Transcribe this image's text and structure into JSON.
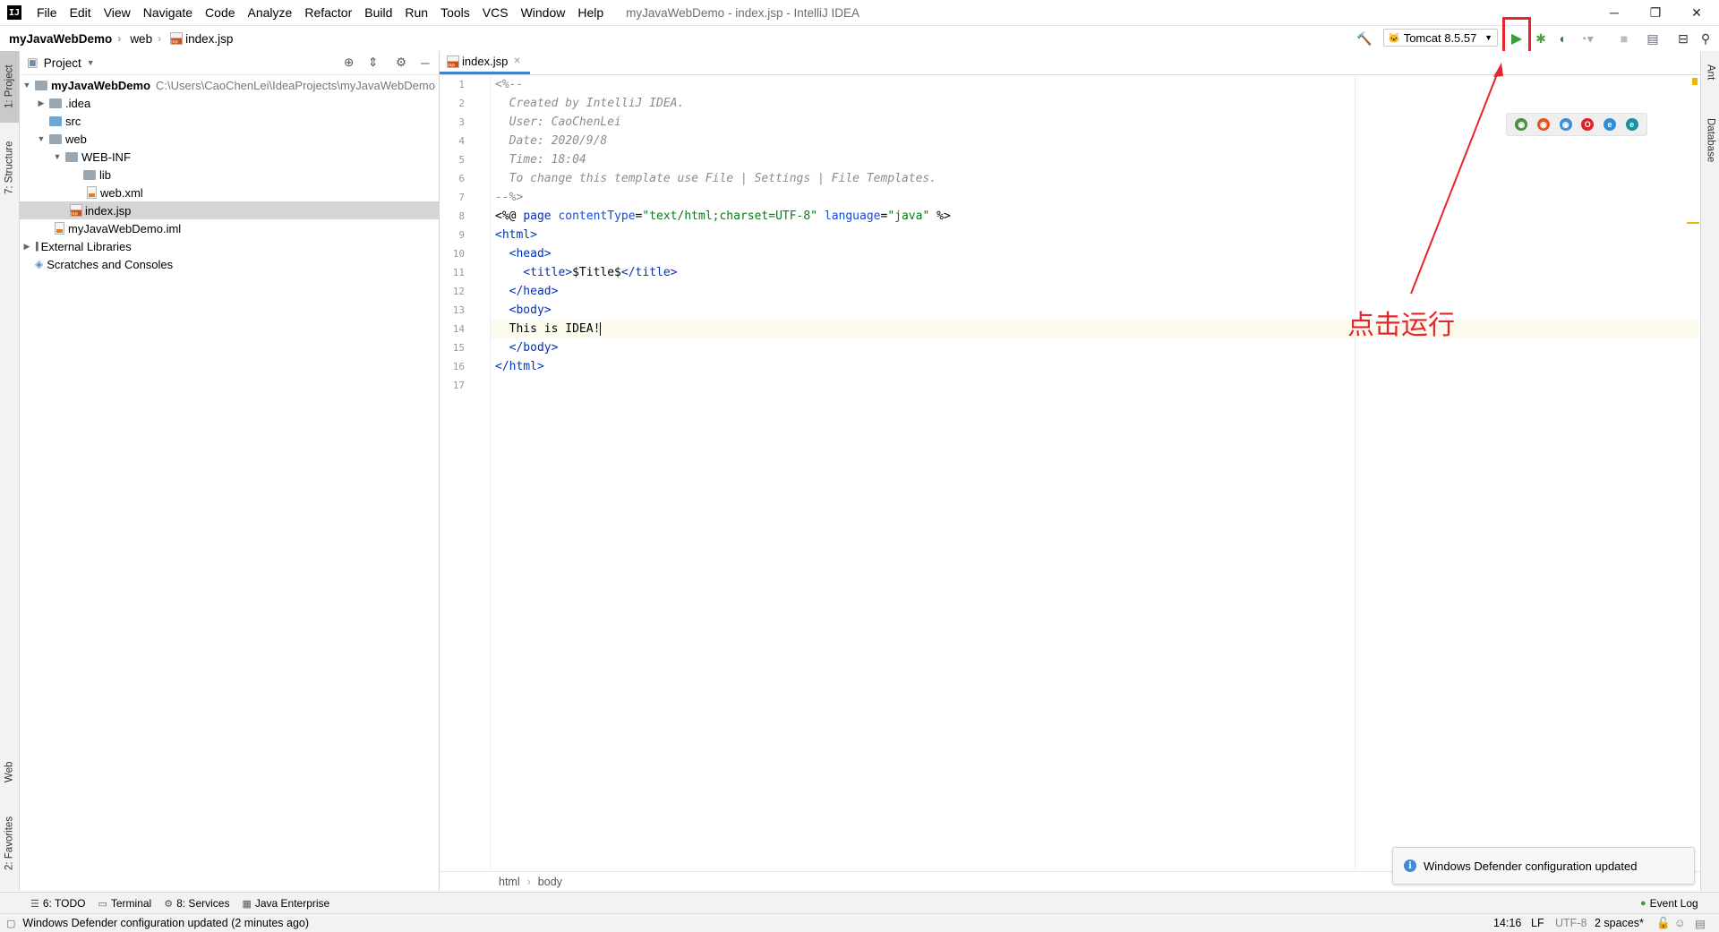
{
  "app": {
    "logo_text": "IJ",
    "window_title": "myJavaWebDemo - index.jsp - IntelliJ IDEA",
    "menu": [
      "File",
      "Edit",
      "View",
      "Navigate",
      "Code",
      "Analyze",
      "Refactor",
      "Build",
      "Run",
      "Tools",
      "VCS",
      "Window",
      "Help"
    ]
  },
  "window_controls": {
    "minimize": "─",
    "restore": "❐",
    "close": "✕"
  },
  "navbar": {
    "crumbs": [
      "myJavaWebDemo",
      "web",
      "index.jsp"
    ],
    "run_config": "Tomcat 8.5.57"
  },
  "toolbar_icons": [
    "build-hammer-icon",
    "run-icon",
    "debug-icon",
    "coverage-icon",
    "profile-icon",
    "stop-icon",
    "project-structure-icon",
    "layout-icon",
    "search-icon"
  ],
  "left_stripe": {
    "project": "1: Project",
    "structure": "7: Structure",
    "web": "Web",
    "favorites": "2: Favorites"
  },
  "right_stripe": {
    "ant": "Ant",
    "database": "Database"
  },
  "project_panel": {
    "title": "Project",
    "root": {
      "name": "myJavaWebDemo",
      "path": "C:\\Users\\CaoChenLei\\IdeaProjects\\myJavaWebDemo"
    },
    "items": [
      {
        "label": ".idea"
      },
      {
        "label": "src"
      },
      {
        "label": "web"
      },
      {
        "label": "WEB-INF"
      },
      {
        "label": "lib"
      },
      {
        "label": "web.xml"
      },
      {
        "label": "index.jsp"
      },
      {
        "label": "myJavaWebDemo.iml"
      },
      {
        "label": "External Libraries"
      },
      {
        "label": "Scratches and Consoles"
      }
    ]
  },
  "editor": {
    "tab": "index.jsp",
    "line_numbers": [
      "1",
      "2",
      "3",
      "4",
      "5",
      "6",
      "7",
      "8",
      "9",
      "10",
      "11",
      "12",
      "13",
      "14",
      "15",
      "16",
      "17"
    ],
    "lines": {
      "l1": "<%--",
      "l2": "  Created by IntelliJ IDEA.",
      "l3": "  User: CaoChenLei",
      "l4": "  Date: 2020/9/8",
      "l5": "  Time: 18:04",
      "l6": "  To change this template use File | Settings | File Templates.",
      "l7": "--%>",
      "l8_a": "<%@ ",
      "l8_b": "page ",
      "l8_c": "contentType",
      "l8_d": "=",
      "l8_e": "\"text/html;charset=UTF-8\"",
      "l8_f": " language",
      "l8_g": "=",
      "l8_h": "\"java\"",
      "l8_i": " %>",
      "l9": "<html>",
      "l10": "  <head>",
      "l11_a": "    <title>",
      "l11_b": "$Title$",
      "l11_c": "</title>",
      "l12": "  </head>",
      "l13": "  <body>",
      "l14": "  This is IDEA!",
      "l15": "  </body>",
      "l16": "</html>"
    },
    "breadcrumb": [
      "html",
      "body"
    ]
  },
  "browsers": [
    {
      "name": "chrome-icon",
      "color": "#4a8f3c"
    },
    {
      "name": "firefox-icon",
      "color": "#e5561f"
    },
    {
      "name": "safari-icon",
      "color": "#3b8be0"
    },
    {
      "name": "opera-icon",
      "color": "#e0202d"
    },
    {
      "name": "ie-icon",
      "color": "#2f8fd8"
    },
    {
      "name": "edge-icon",
      "color": "#1d8fa0"
    }
  ],
  "annotation": {
    "text": "点击运行",
    "color": "#e8252c"
  },
  "notification": {
    "text": "Windows Defender configuration updated"
  },
  "bottom_tabs": {
    "todo": "6: TODO",
    "terminal": "Terminal",
    "services": "8: Services",
    "java_enterprise": "Java Enterprise",
    "event_log": "Event Log"
  },
  "status_bar": {
    "message": "Windows Defender configuration updated (2 minutes ago)",
    "position": "14:16",
    "line_sep": "LF",
    "encoding": "UTF-8",
    "indent": "2 spaces*"
  }
}
